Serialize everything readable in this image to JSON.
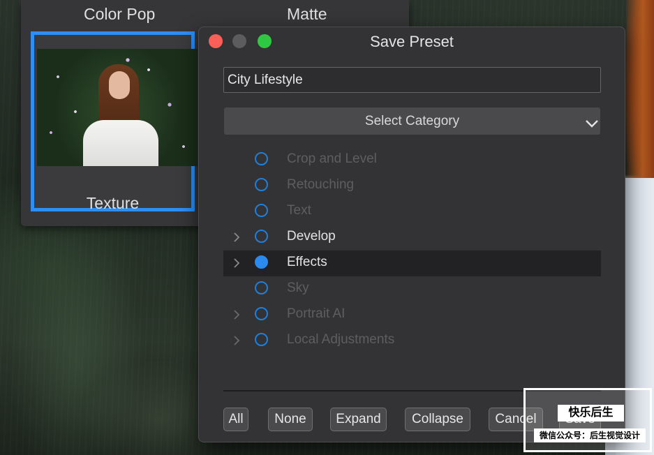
{
  "background_presets": {
    "items": [
      {
        "label": "Color Pop"
      },
      {
        "label": "Matte"
      },
      {
        "label": "Texture",
        "selected": true,
        "favorite_icon": "heart-icon"
      }
    ]
  },
  "dialog": {
    "title": "Save Preset",
    "name_input": {
      "value": "City Lifestyle"
    },
    "category_select": {
      "label": "Select Category",
      "icon": "chevron-down-icon"
    },
    "categories": [
      {
        "label": "Crop and Level",
        "enabled": false,
        "expandable": false,
        "selected": false
      },
      {
        "label": "Retouching",
        "enabled": false,
        "expandable": false,
        "selected": false
      },
      {
        "label": "Text",
        "enabled": false,
        "expandable": false,
        "selected": false
      },
      {
        "label": "Develop",
        "enabled": true,
        "expandable": true,
        "selected": false
      },
      {
        "label": "Effects",
        "enabled": true,
        "expandable": true,
        "selected": true
      },
      {
        "label": "Sky",
        "enabled": false,
        "expandable": false,
        "selected": false
      },
      {
        "label": "Portrait AI",
        "enabled": false,
        "expandable": true,
        "selected": false
      },
      {
        "label": "Local Adjustments",
        "enabled": false,
        "expandable": true,
        "selected": false
      }
    ],
    "buttons": {
      "all": "All",
      "none": "None",
      "expand": "Expand",
      "collapse": "Collapse",
      "cancel": "Cancel",
      "save": "Save"
    }
  },
  "watermark": {
    "title": "快乐后生",
    "subtitle": "微信公众号：后生视觉设计"
  },
  "colors": {
    "accent": "#2d8ff5",
    "close": "#fc5f57",
    "maximize": "#2fc843"
  }
}
